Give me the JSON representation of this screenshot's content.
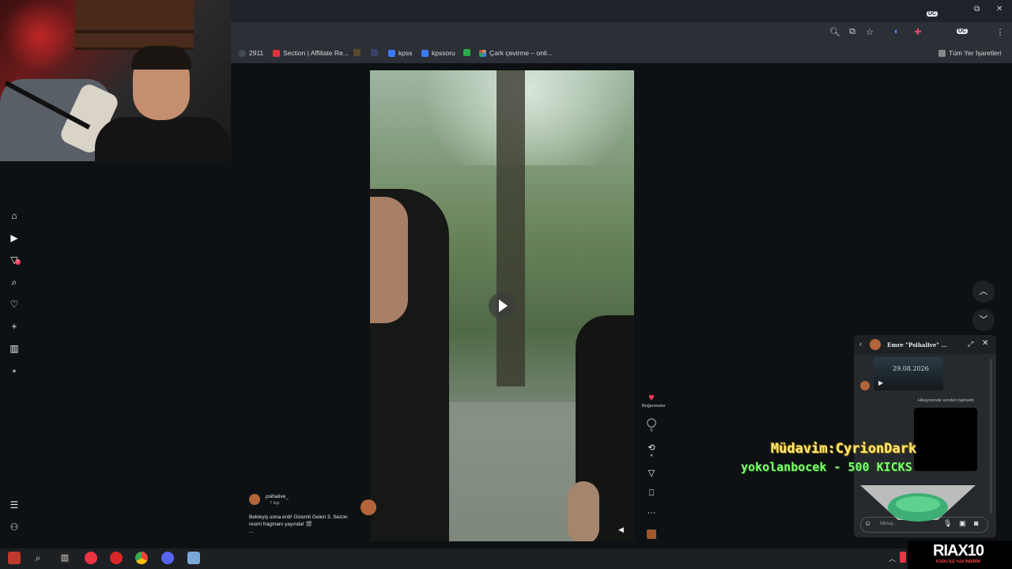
{
  "browser": {
    "bookmarks": [
      {
        "label": "2911",
        "color": "#444b55"
      },
      {
        "label": "Section | Affiliate Re...",
        "color": "#e2333d"
      },
      {
        "label": "",
        "color": "#5a4a2a"
      },
      {
        "label": "",
        "color": "#3a3f6a"
      },
      {
        "label": "kpss",
        "color": "#3d7bf5"
      },
      {
        "label": "kpssoru",
        "color": "#3d7bf5"
      },
      {
        "label": "",
        "color": "#2aa84a"
      },
      {
        "label": "Çark çevirme – onli...",
        "color": "#e8a23a"
      }
    ],
    "all_bookmarks_label": "Tüm Yer İşaretleri",
    "badges": [
      "UC",
      "UC"
    ]
  },
  "sidebar": {
    "icons": [
      "home-icon",
      "play-icon",
      "filter-icon",
      "search-icon",
      "heart-icon",
      "plus-icon",
      "chart-icon",
      "avatar"
    ],
    "notification_count": "2"
  },
  "post": {
    "author": "psihalive_",
    "audience": "7 kişi",
    "caption_line1": "Bekleyiş sona erdi! Gizemli Gelen 3. Sezon",
    "caption_line2": "resmi fragmanı yayında! 🎬",
    "caption_more": "..."
  },
  "actions": {
    "likes_label": "Beğenmeler",
    "comments_count": "5",
    "reposts_count": "4"
  },
  "chat": {
    "title": "Emre \"Psihalive\" ...",
    "story_date": "29.08.2026",
    "mention_text": "Hikayesinde senden bahsetti",
    "message_placeholder": "Mesaj..."
  },
  "overlay": {
    "moda_line1": "Müdavim:CyrionDark",
    "moda_line2": "yokolanbocek - 500 KICKS",
    "brand": "RIAX10",
    "brand_sub": "KODU İLE %10 İNDİRİM"
  },
  "colors": {
    "background": "#0d1114",
    "like_red": "#ff3b5c",
    "overlay_yellow": "#ffe97a",
    "overlay_green": "#7cff6a"
  }
}
